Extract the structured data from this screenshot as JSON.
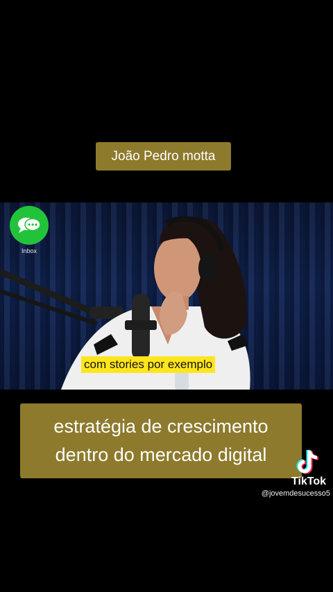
{
  "header": {
    "name_tag": "João Pedro motta"
  },
  "inbox": {
    "label": "Inbox",
    "icon": "chat-bubbles-icon",
    "color": "#22c33b"
  },
  "video": {
    "subtitle": "com stories por exemplo"
  },
  "caption": {
    "line1": "estratégia de crescimento",
    "line2": "dentro do mercado digital"
  },
  "watermark": {
    "brand": "TikTok",
    "handle": "@jovemdesucesso5",
    "icon": "tiktok-note-icon"
  },
  "colors": {
    "tag_bg": "#8d7a2c",
    "subtitle_bg": "#ffe51c"
  }
}
